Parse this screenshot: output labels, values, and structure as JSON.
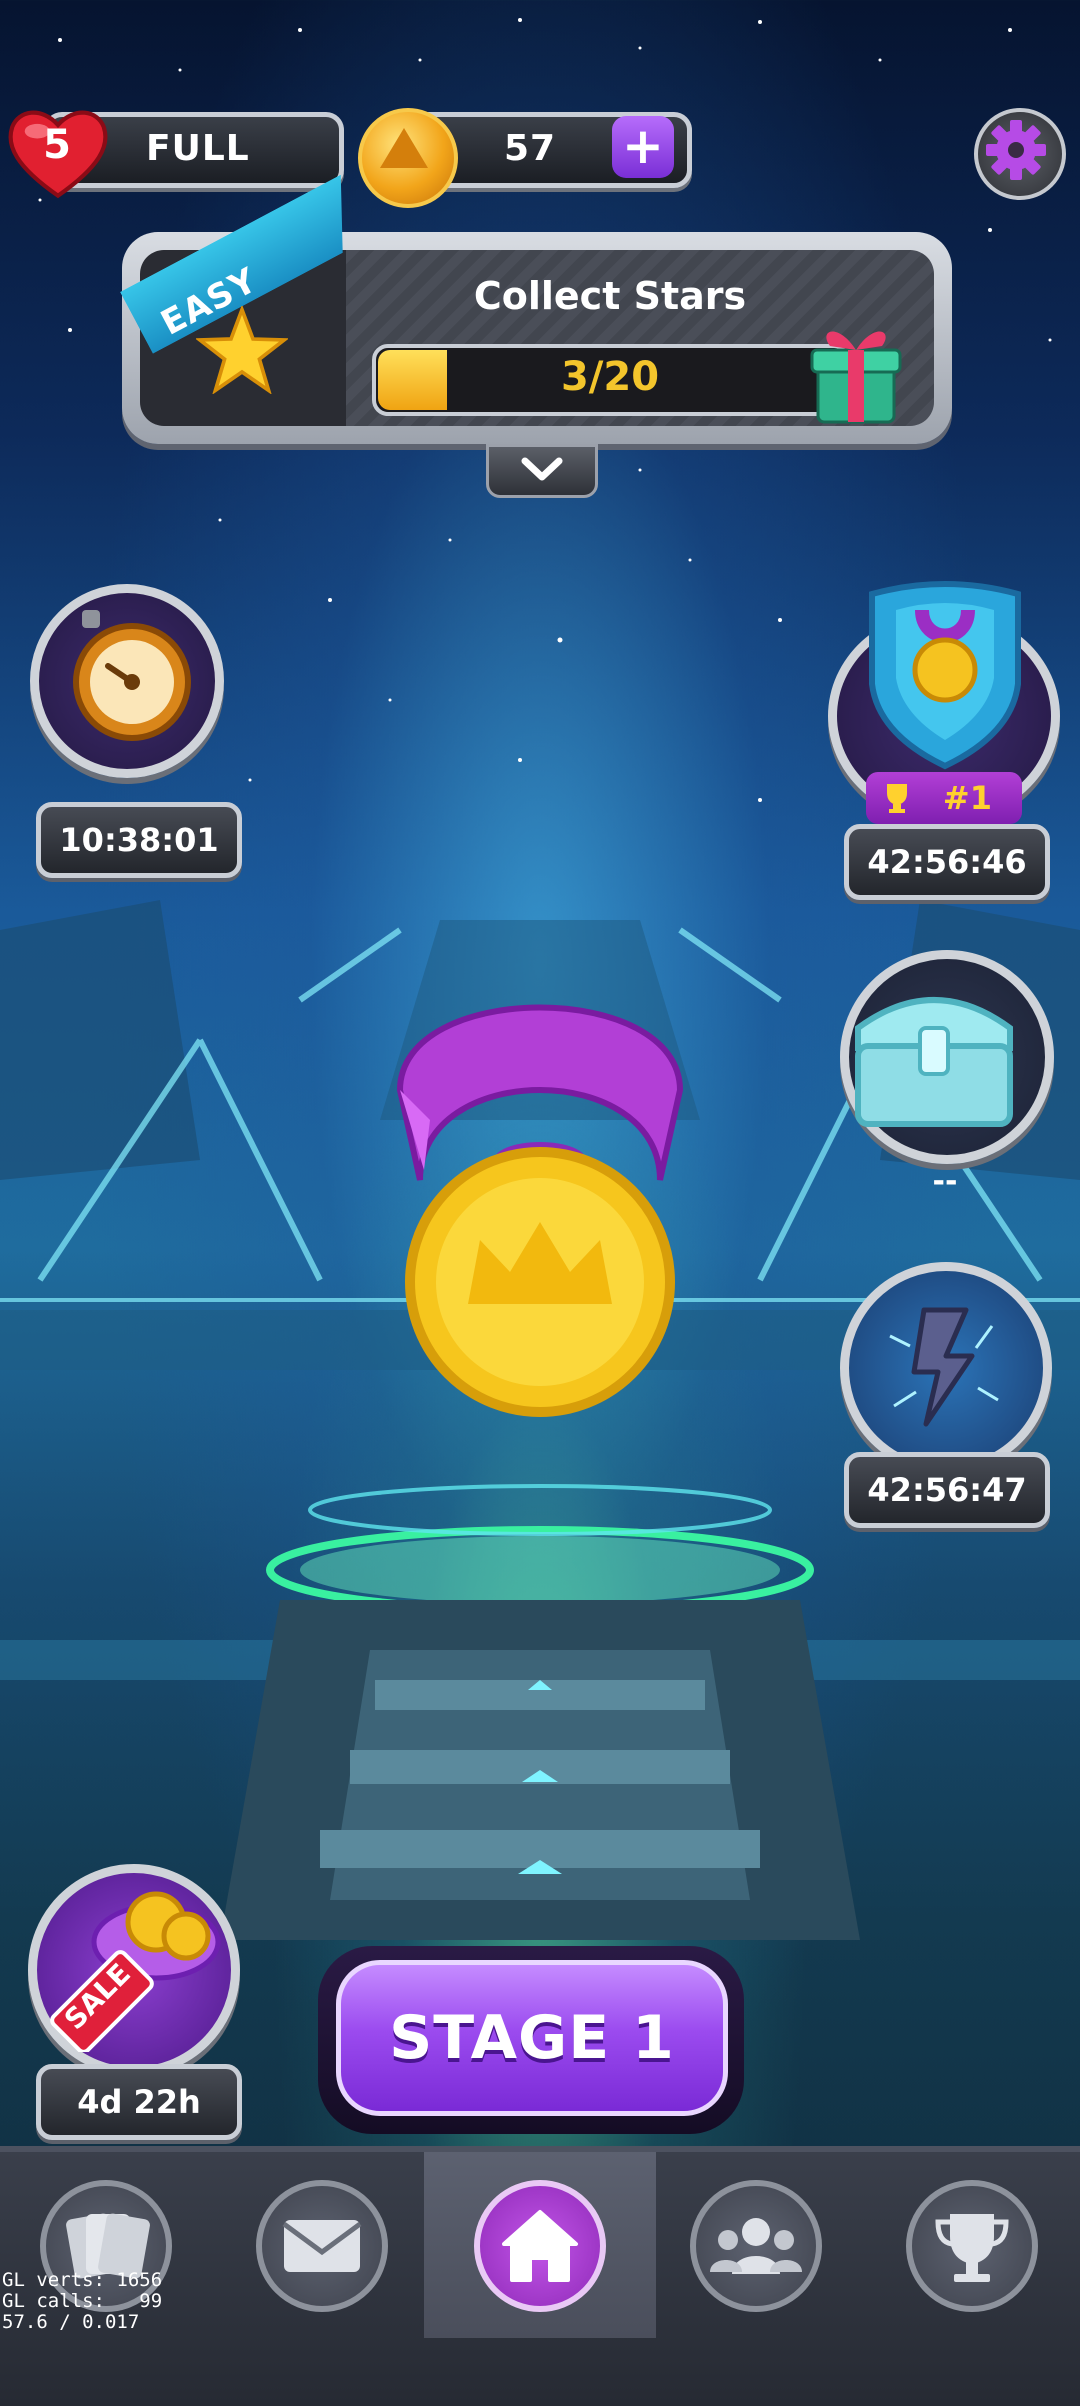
{
  "top_bar": {
    "lives": {
      "count": "5",
      "status": "FULL"
    },
    "coins": {
      "amount": "57",
      "add_label": "+"
    },
    "settings_icon": "gear-icon"
  },
  "quest": {
    "difficulty": "EASY",
    "title": "Collect Stars",
    "progress_text": "3/20",
    "progress_fraction": 0.15,
    "reward_icon": "gift-icon",
    "expand_icon": "chevron-down-icon"
  },
  "side_events": {
    "left_timer_event": {
      "icon": "compass-clock-icon",
      "timer": "10:38:01"
    },
    "league": {
      "icon": "shield-medal-icon",
      "rank": "#1",
      "timer": "42:56:46"
    },
    "chest": {
      "icon": "treasure-chest-icon",
      "status": "--"
    },
    "lightning": {
      "icon": "lightning-icon",
      "timer": "42:56:47"
    },
    "sale": {
      "icon": "sale-coins-icon",
      "badge": "SALE",
      "timer": "4d 22h"
    }
  },
  "center": {
    "icon": "crown-medal-icon"
  },
  "play_button": {
    "label": "STAGE 1"
  },
  "nav": {
    "items": [
      {
        "name": "cards",
        "icon": "cards-icon"
      },
      {
        "name": "mail",
        "icon": "mail-icon"
      },
      {
        "name": "home",
        "icon": "home-icon",
        "active": true
      },
      {
        "name": "friends",
        "icon": "friends-icon"
      },
      {
        "name": "leaderboard",
        "icon": "trophy-icon"
      }
    ]
  },
  "debug": {
    "line1": "GL verts: 1656",
    "line2": "GL calls:   99",
    "line3": "57.6 / 0.017"
  },
  "colors": {
    "accent_purple": "#9b4bef",
    "gold": "#f2a51a",
    "cyan": "#37c5e8"
  }
}
